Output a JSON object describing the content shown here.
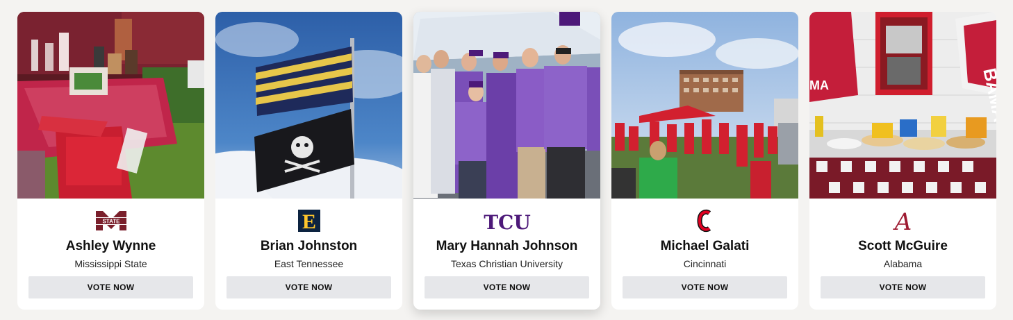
{
  "candidates": [
    {
      "name": "Ashley Wynne",
      "school": "Mississippi State",
      "vote_label": "VOTE NOW",
      "logo_text": "STATE",
      "logo_color": "#7a1f2b",
      "logo_icon": "mississippi-state-logo-icon",
      "photo_icon": "tailgate-tent-photo-icon"
    },
    {
      "name": "Brian Johnston",
      "school": "East Tennessee",
      "vote_label": "VOTE NOW",
      "logo_text": "E",
      "logo_color": "#0c2340",
      "logo_icon": "etsu-logo-icon",
      "photo_icon": "flags-sky-photo-icon"
    },
    {
      "name": "Mary Hannah Johnson",
      "school": "Texas Christian University",
      "vote_label": "VOTE NOW",
      "logo_text": "TCU",
      "logo_color": "#4d1979",
      "logo_icon": "tcu-logo-icon",
      "photo_icon": "fans-group-photo-icon"
    },
    {
      "name": "Michael Galati",
      "school": "Cincinnati",
      "vote_label": "VOTE NOW",
      "logo_text": "C",
      "logo_color": "#e00122",
      "logo_icon": "cincinnati-logo-icon",
      "photo_icon": "tailgate-crowd-photo-icon"
    },
    {
      "name": "Scott McGuire",
      "school": "Alabama",
      "vote_label": "VOTE NOW",
      "logo_text": "A",
      "logo_color": "#9e1b32",
      "logo_icon": "alabama-logo-icon",
      "photo_icon": "food-spread-photo-icon",
      "photo_banner_text": "BAMA",
      "photo_banner_text_left": "MA"
    }
  ],
  "colors": {
    "page_bg": "#f4f3f1",
    "card_bg": "#ffffff",
    "button_bg": "#e6e7ea"
  }
}
